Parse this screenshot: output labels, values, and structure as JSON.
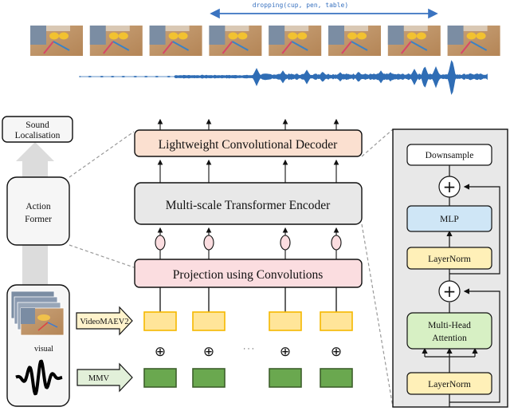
{
  "top_strip": {
    "action_label": "dropping(cup, pen, table)",
    "frame_count": 8,
    "colors": {
      "annotation": "#3a73c0",
      "waveform": "#2f6db5"
    }
  },
  "left_panel": {
    "output_box": {
      "line1": "Sound",
      "line2": "Localisation"
    },
    "model_box": {
      "line1": "Action",
      "line2": "Former"
    },
    "input_box": {
      "visual_label": "visual"
    }
  },
  "center_panel": {
    "decoder_label": "Lightweight Convolutional Decoder",
    "encoder_label": "Multi-scale Transformer Encoder",
    "projection_label": "Projection using Convolutions",
    "visual_feature_arrow": "VideoMAEV2",
    "audio_feature_arrow": "MMV",
    "ellipsis": "· · ·",
    "combine_symbol": "⊕",
    "token_columns": 4,
    "colors": {
      "decoder_fill": "#fbe0d0",
      "encoder_fill": "#e8e8e8",
      "projection_fill": "#fbdde0",
      "visual_token_fill": "#ffe599",
      "visual_token_border": "#f5b800",
      "audio_token_fill": "#6aa84f",
      "audio_token_border": "#3d5f2c"
    }
  },
  "right_panel": {
    "blocks": {
      "downsample": "Downsample",
      "mlp": "MLP",
      "layernorm_top": "LayerNorm",
      "attention_line1": "Multi-Head",
      "attention_line2": "Attention",
      "layernorm_bottom": "LayerNorm"
    },
    "add_symbol": "+",
    "colors": {
      "panel_fill": "#e8e8e8",
      "mlp_fill": "#cfe6f6",
      "layernorm_fill": "#fff0b8",
      "attention_fill": "#d7f0c4"
    }
  }
}
